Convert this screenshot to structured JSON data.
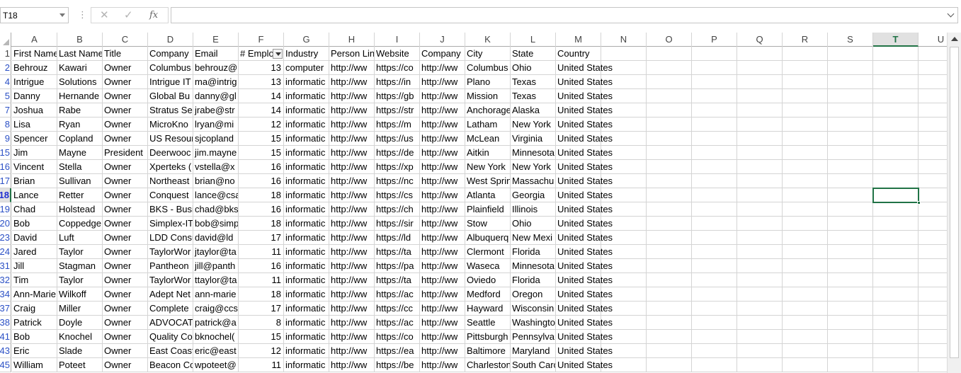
{
  "formula_bar": {
    "name_box": "T18",
    "dots": "⋮",
    "cancel": "✕",
    "enter": "✓",
    "fx": "fx",
    "formula": ""
  },
  "columns": [
    "A",
    "B",
    "C",
    "D",
    "E",
    "F",
    "G",
    "H",
    "I",
    "J",
    "K",
    "L",
    "M",
    "N",
    "O",
    "P",
    "Q",
    "R",
    "S",
    "T",
    "U"
  ],
  "active_column": "T",
  "active_row": "18",
  "header_row": {
    "row_num": "1",
    "cells": [
      "First Name",
      "Last Name",
      "Title",
      "Company",
      "Email",
      "# Emplo",
      "Industry",
      "Person Lin",
      "Website",
      "Company",
      "City",
      "State",
      "Country"
    ]
  },
  "rows": [
    {
      "n": "2",
      "c": [
        "Behrouz",
        "Kawari",
        "Owner",
        "Columbus",
        "behrouz@",
        "13",
        "computer",
        "http://ww",
        "https://co",
        "http://ww",
        "Columbus",
        "Ohio",
        "United States"
      ]
    },
    {
      "n": "4",
      "c": [
        "Intrigue",
        "Solutions",
        "Owner",
        "Intrigue IT",
        "ma@intrig",
        "13",
        "informatic",
        "http://ww",
        "https://in",
        "http://ww",
        "Plano",
        "Texas",
        "United States"
      ]
    },
    {
      "n": "5",
      "c": [
        "Danny",
        "Hernande",
        "Owner",
        "Global Bu",
        "danny@gl",
        "14",
        "informatic",
        "http://ww",
        "https://gb",
        "http://ww",
        "Mission",
        "Texas",
        "United States"
      ]
    },
    {
      "n": "7",
      "c": [
        "Joshua",
        "Rabe",
        "Owner",
        "Stratus Se",
        "jrabe@str",
        "14",
        "informatic",
        "http://ww",
        "https://str",
        "http://ww",
        "Anchorage",
        "Alaska",
        "United States"
      ]
    },
    {
      "n": "8",
      "c": [
        "Lisa",
        "Ryan",
        "Owner",
        "MicroKno",
        "lryan@mi",
        "12",
        "informatic",
        "http://ww",
        "https://m",
        "http://ww",
        "Latham",
        "New York",
        "United States"
      ]
    },
    {
      "n": "9",
      "c": [
        "Spencer",
        "Copland",
        "Owner",
        "US Resour",
        "sjcopland",
        "15",
        "informatic",
        "http://ww",
        "https://us",
        "http://ww",
        "McLean",
        "Virginia",
        "United States"
      ]
    },
    {
      "n": "15",
      "c": [
        "Jim",
        "Mayne",
        "President",
        "Deerwooc",
        "jim.mayne",
        "15",
        "informatic",
        "http://ww",
        "https://de",
        "http://ww",
        "Aitkin",
        "Minnesota",
        "United States"
      ]
    },
    {
      "n": "16",
      "c": [
        "Vincent",
        "Stella",
        "Owner",
        "Xperteks (",
        "vstella@x",
        "16",
        "informatic",
        "http://ww",
        "https://xp",
        "http://ww",
        "New York",
        "New York",
        "United States"
      ]
    },
    {
      "n": "17",
      "c": [
        "Brian",
        "Sullivan",
        "Owner",
        "Northeast",
        "brian@no",
        "16",
        "informatic",
        "http://ww",
        "https://nc",
        "http://ww",
        "West Sprin",
        "Massachu",
        "United States"
      ]
    },
    {
      "n": "18",
      "c": [
        "Lance",
        "Retter",
        "Owner",
        "Conquest",
        "lance@csa",
        "18",
        "informatic",
        "http://ww",
        "https://cs",
        "http://ww",
        "Atlanta",
        "Georgia",
        "United States"
      ]
    },
    {
      "n": "19",
      "c": [
        "Chad",
        "Holstead",
        "Owner",
        "BKS - Busi",
        "chad@bks",
        "16",
        "informatic",
        "http://ww",
        "https://ch",
        "http://ww",
        "Plainfield",
        "Illinois",
        "United States"
      ]
    },
    {
      "n": "20",
      "c": [
        "Bob",
        "Coppedge",
        "Owner",
        "Simplex-IT",
        "bob@simp",
        "18",
        "informatic",
        "http://ww",
        "https://sir",
        "http://ww",
        "Stow",
        "Ohio",
        "United States"
      ]
    },
    {
      "n": "23",
      "c": [
        "David",
        "Luft",
        "Owner",
        "LDD Consu",
        "david@ld",
        "17",
        "informatic",
        "http://ww",
        "https://ld",
        "http://ww",
        "Albuquerq",
        "New Mexi",
        "United States"
      ]
    },
    {
      "n": "24",
      "c": [
        "Jared",
        "Taylor",
        "Owner",
        "TaylorWor",
        "jtaylor@ta",
        "11",
        "informatic",
        "http://ww",
        "https://ta",
        "http://ww",
        "Clermont",
        "Florida",
        "United States"
      ]
    },
    {
      "n": "31",
      "c": [
        "Jill",
        "Stagman",
        "Owner",
        "Pantheon",
        "jill@panth",
        "16",
        "informatic",
        "http://ww",
        "https://pa",
        "http://ww",
        "Waseca",
        "Minnesota",
        "United States"
      ]
    },
    {
      "n": "32",
      "c": [
        "Tim",
        "Taylor",
        "Owner",
        "TaylorWor",
        "ttaylor@ta",
        "11",
        "informatic",
        "http://ww",
        "https://ta",
        "http://ww",
        "Oviedo",
        "Florida",
        "United States"
      ]
    },
    {
      "n": "34",
      "c": [
        "Ann-Marie",
        "Wilkoff",
        "Owner",
        "Adept Net",
        "ann-marie",
        "18",
        "informatic",
        "http://ww",
        "https://ac",
        "http://ww",
        "Medford",
        "Oregon",
        "United States"
      ]
    },
    {
      "n": "37",
      "c": [
        "Craig",
        "Miller",
        "Owner",
        "Complete",
        "craig@ccs",
        "17",
        "informatic",
        "http://ww",
        "https://cc",
        "http://ww",
        "Hayward",
        "Wisconsin",
        "United States"
      ]
    },
    {
      "n": "38",
      "c": [
        "Patrick",
        "Doyle",
        "Owner",
        "ADVOCAT",
        "patrick@a",
        "8",
        "informatic",
        "http://ww",
        "https://ac",
        "http://ww",
        "Seattle",
        "Washingto",
        "United States"
      ]
    },
    {
      "n": "41",
      "c": [
        "Bob",
        "Knochel",
        "Owner",
        "Quality Co",
        "bknochel(",
        "15",
        "informatic",
        "http://ww",
        "https://co",
        "http://ww",
        "Pittsburgh",
        "Pennsylva",
        "United States"
      ]
    },
    {
      "n": "43",
      "c": [
        "Eric",
        "Slade",
        "Owner",
        "East Coast",
        "eric@east",
        "12",
        "informatic",
        "http://ww",
        "https://ea",
        "http://ww",
        "Baltimore",
        "Maryland",
        "United States"
      ]
    },
    {
      "n": "45",
      "c": [
        "William",
        "Poteet",
        "Owner",
        "Beacon Co",
        "wpoteet@",
        "11",
        "informatic",
        "http://ww",
        "https://be",
        "http://ww",
        "Charleston",
        "South Caro",
        "United States"
      ]
    }
  ]
}
